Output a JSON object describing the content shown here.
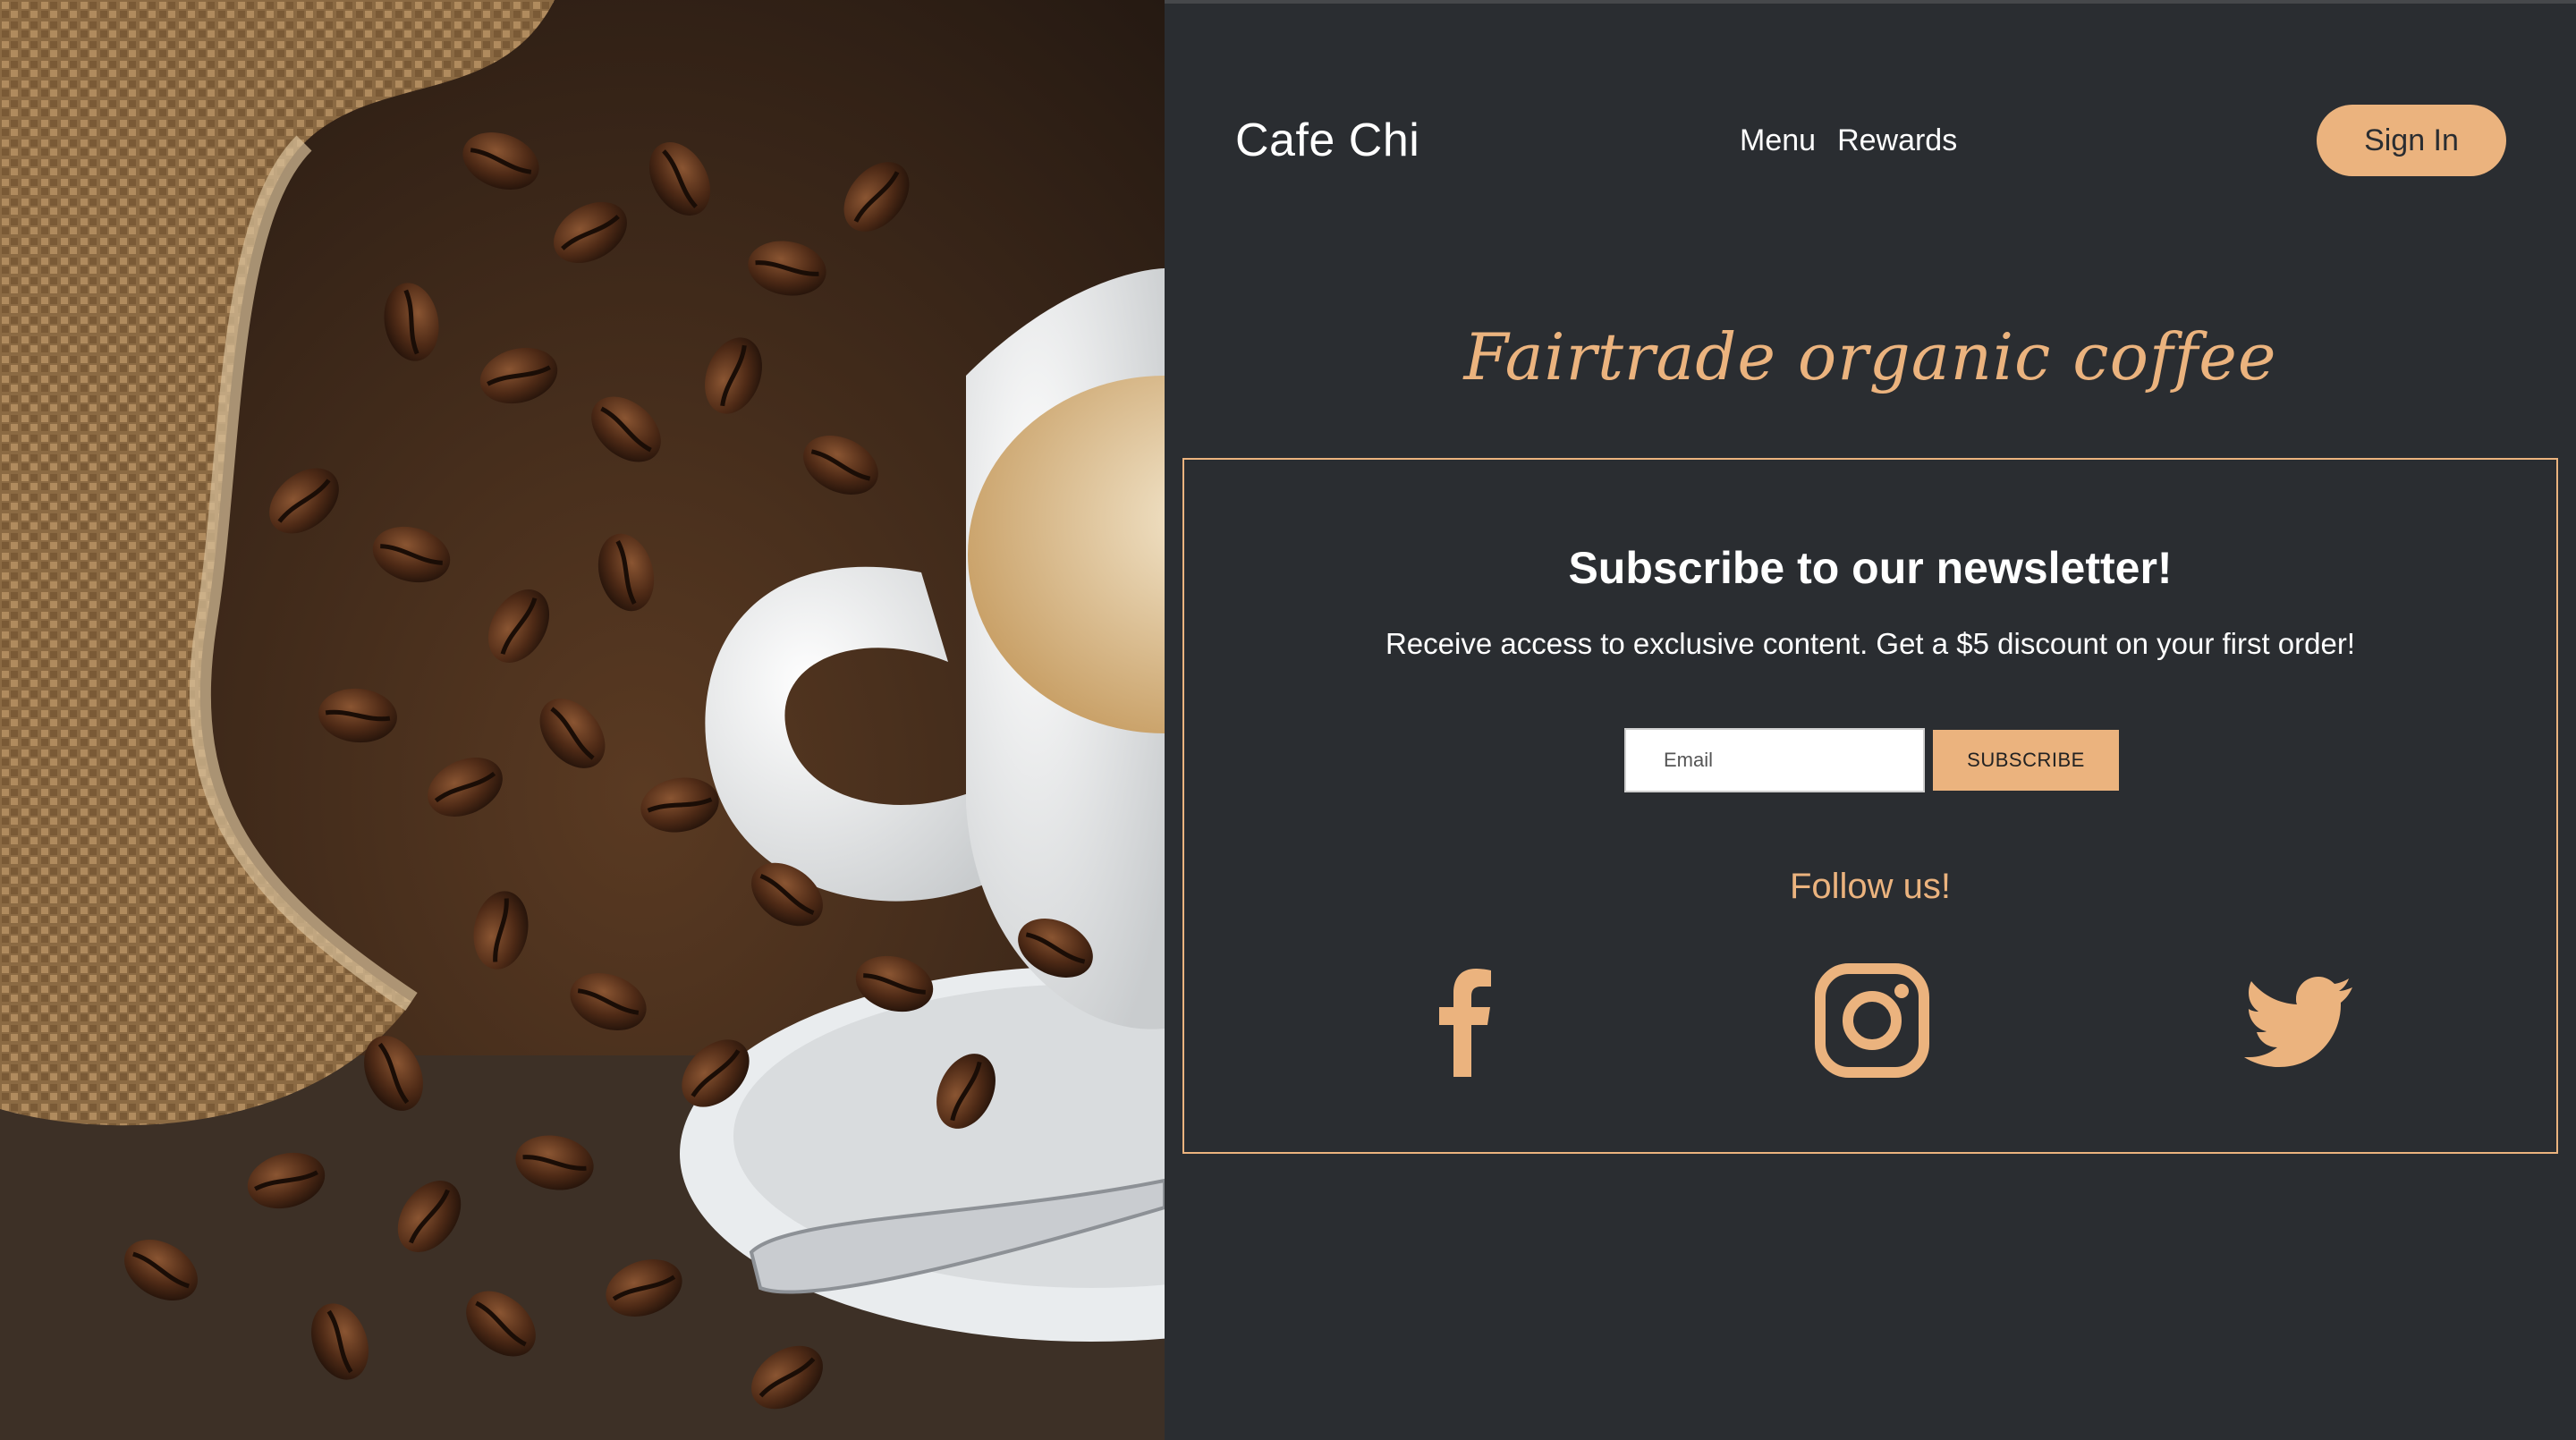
{
  "brand": {
    "name": "Cafe Chi"
  },
  "nav": {
    "items": [
      "Menu",
      "Rewards"
    ]
  },
  "header": {
    "signin_label": "Sign In"
  },
  "hero": {
    "tagline": "Fairtrade organic coffee"
  },
  "newsletter": {
    "title": "Subscribe to our newsletter!",
    "subtitle": "Receive access to exclusive content. Get a $5 discount on your first order!",
    "email_placeholder": "Email",
    "subscribe_label": "SUBSCRIBE",
    "follow_label": "Follow us!"
  },
  "social": {
    "icons": [
      "facebook-icon",
      "instagram-icon",
      "twitter-icon"
    ]
  },
  "colors": {
    "accent": "#ebb37e",
    "background": "#2a2d31",
    "text": "#ffffff"
  }
}
